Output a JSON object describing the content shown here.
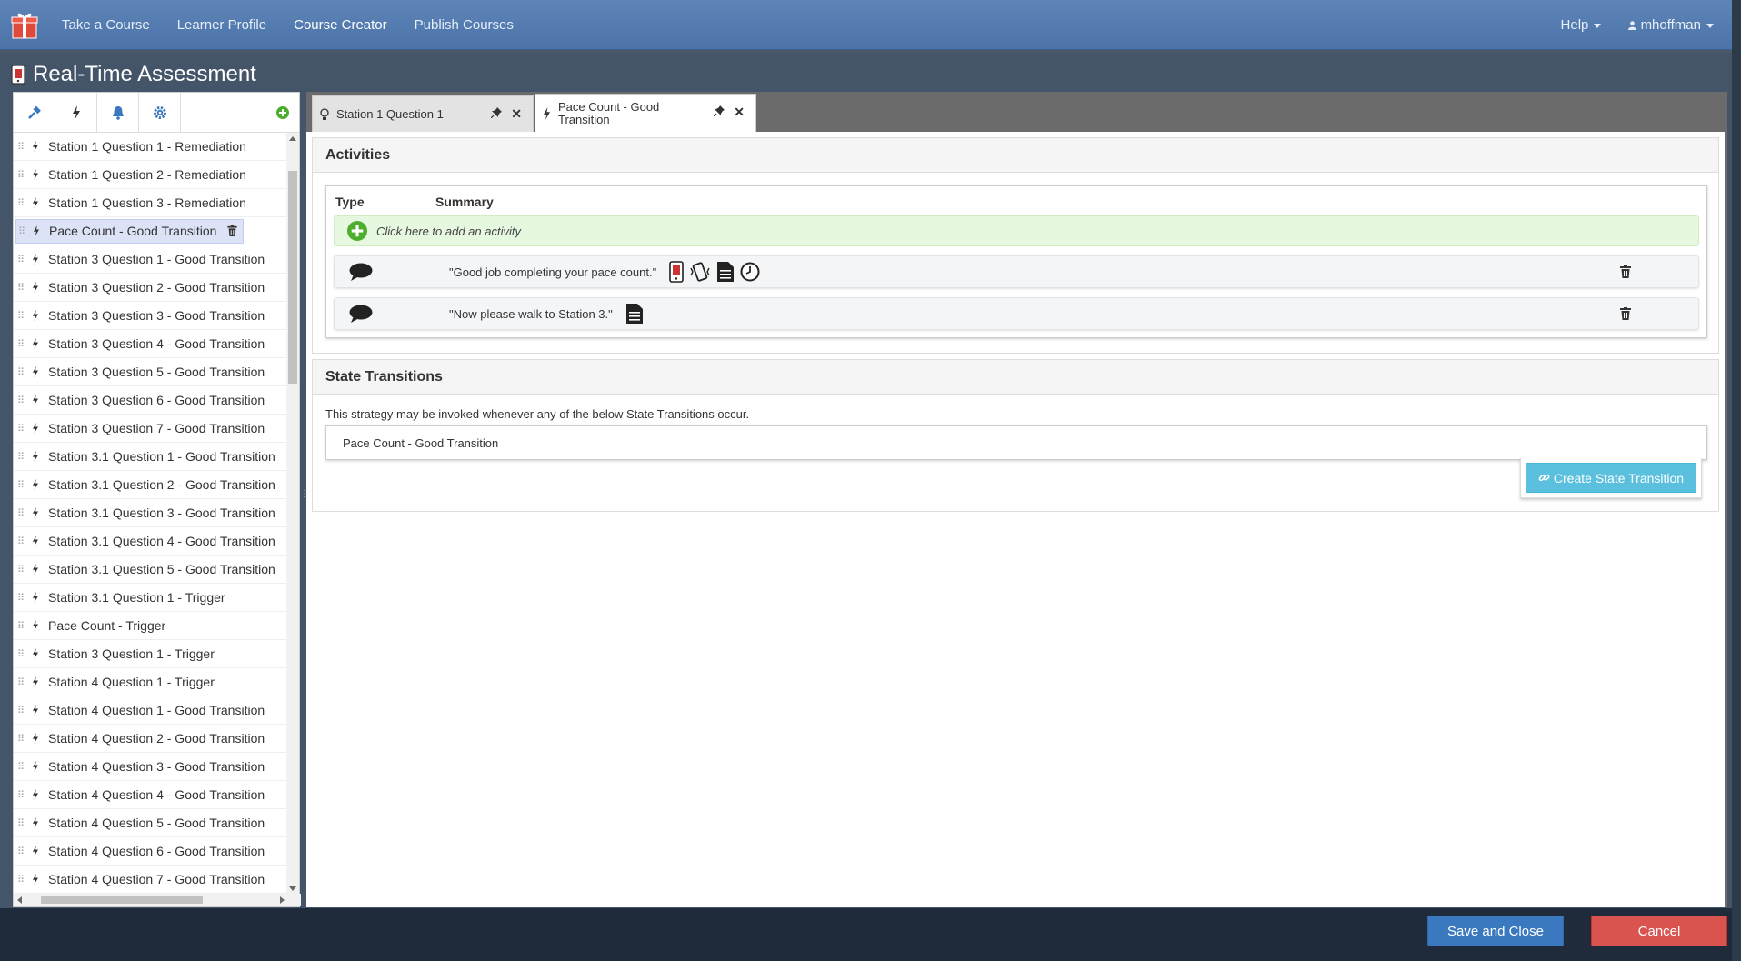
{
  "nav": {
    "links": [
      "Take a Course",
      "Learner Profile",
      "Course Creator",
      "Publish Courses"
    ],
    "help_label": "Help",
    "user_label": "mhoffman"
  },
  "modal": {
    "title": "Real-Time Assessment"
  },
  "sidebar": {
    "items": [
      "Station 1 Question 1 - Remediation",
      "Station 1 Question 2 - Remediation",
      "Station 1 Question 3 - Remediation",
      "Pace Count - Good Transition",
      "Station 3 Question 1 - Good Transition",
      "Station 3 Question 2 - Good Transition",
      "Station 3 Question 3 - Good Transition",
      "Station 3 Question 4 - Good Transition",
      "Station 3 Question 5 - Good Transition",
      "Station 3 Question 6 - Good Transition",
      "Station 3 Question 7 - Good Transition",
      "Station 3.1 Question 1 - Good Transition",
      "Station 3.1 Question 2 - Good Transition",
      "Station 3.1 Question 3 - Good Transition",
      "Station 3.1 Question 4 - Good Transition",
      "Station 3.1 Question 5 - Good Transition",
      "Station 3.1 Question 1 - Trigger",
      "Pace Count - Trigger",
      "Station 3 Question 1 - Trigger",
      "Station 4 Question 1 - Trigger",
      "Station 4 Question 1 - Good Transition",
      "Station 4 Question 2 - Good Transition",
      "Station 4 Question 3 - Good Transition",
      "Station 4 Question 4 - Good Transition",
      "Station 4 Question 5 - Good Transition",
      "Station 4 Question 6 - Good Transition",
      "Station 4 Question 7 - Good Transition"
    ]
  },
  "tabs": {
    "tab1": "Station 1 Question 1",
    "tab2": "Pace Count - Good Transition"
  },
  "activities": {
    "heading": "Activities",
    "col_type": "Type",
    "col_summary": "Summary",
    "add_prompt": "Click here to add an activity",
    "row1_summary": "\"Good job completing your pace count.\"",
    "row2_summary": "\"Now please walk to Station 3.\""
  },
  "state_transitions": {
    "heading": "State Transitions",
    "description": "This strategy may be invoked whenever any of the below State Transitions occur.",
    "item": "Pace Count - Good Transition",
    "create_label": "Create State Transition"
  },
  "footer": {
    "save_label": "Save and Close",
    "cancel_label": "Cancel"
  },
  "colors": {
    "navbar": "#5679ad",
    "save": "#3a78bf",
    "cancel": "#d9534f",
    "create": "#5bc0de",
    "add_green": "#4cae2c"
  }
}
